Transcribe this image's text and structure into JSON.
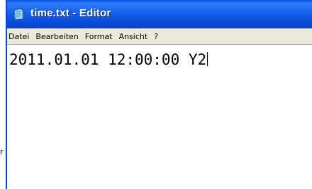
{
  "window": {
    "title": "time.txt - Editor",
    "icon": "notepad-icon"
  },
  "menu": {
    "items": [
      "Datei",
      "Bearbeiten",
      "Format",
      "Ansicht",
      "?"
    ]
  },
  "editor": {
    "content": "2011.01.01 12:00:00 Y2"
  },
  "background": {
    "partial_text": "r"
  },
  "colors": {
    "titlebar": "#0a4ad6",
    "menubar": "#ece9d8",
    "editor_bg": "#ffffff",
    "window_border": "#0b46d8"
  }
}
